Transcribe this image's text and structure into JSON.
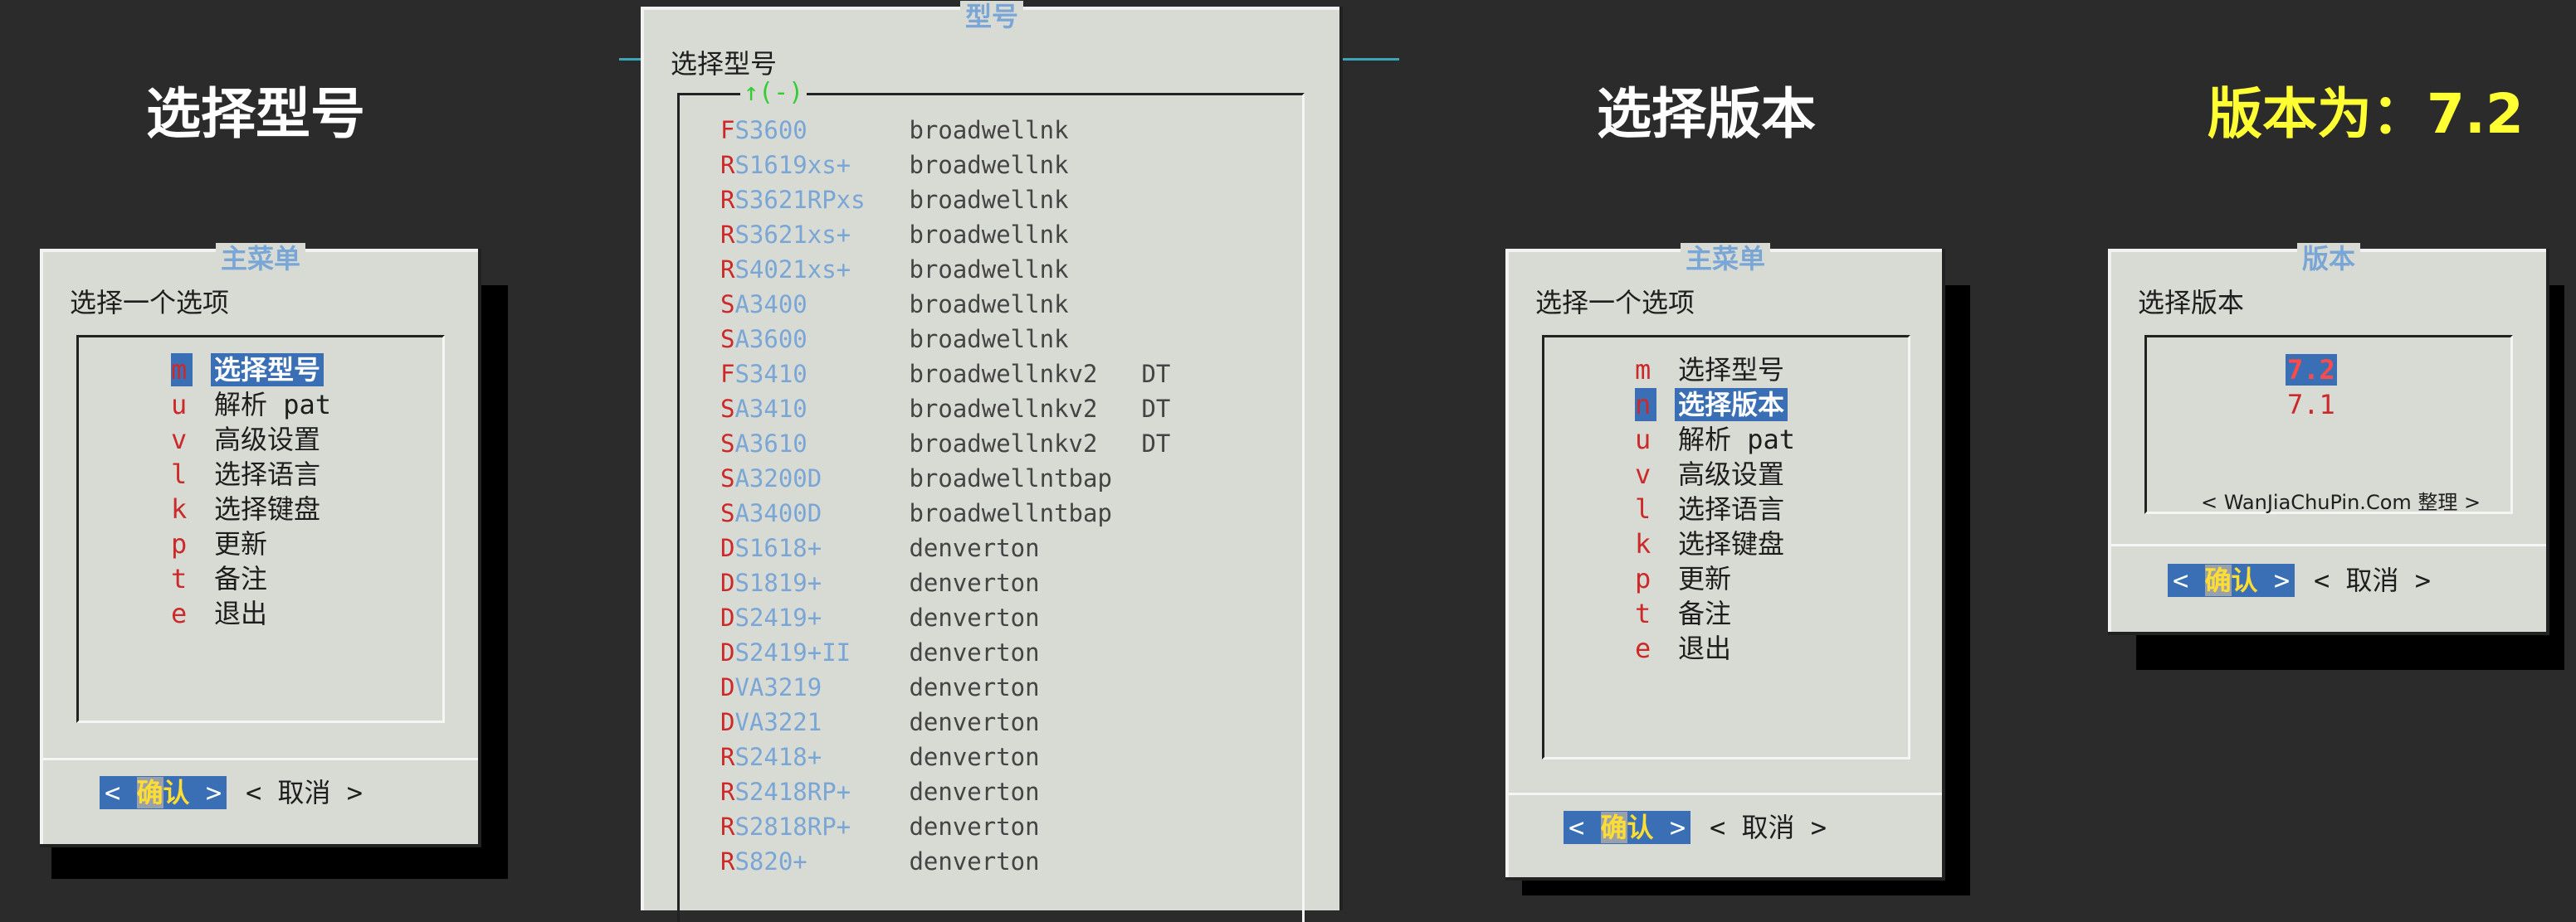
{
  "headings": {
    "select_model": "选择型号",
    "select_version": "选择版本",
    "version_result": "版本为：7.2"
  },
  "menu1": {
    "title": "主菜单",
    "prompt": "选择一个选项",
    "items": [
      {
        "key": "m",
        "label": "选择型号"
      },
      {
        "key": "u",
        "label": "解析 pat"
      },
      {
        "key": "v",
        "label": "高级设置"
      },
      {
        "key": "l",
        "label": "选择语言"
      },
      {
        "key": "k",
        "label": "选择键盘"
      },
      {
        "key": "p",
        "label": "更新"
      },
      {
        "key": "t",
        "label": "备注"
      },
      {
        "key": "e",
        "label": "退出"
      }
    ],
    "ok": {
      "left": "<",
      "hot": "确",
      "rest": "认",
      "right": ">"
    },
    "cancel": "< 取消 >"
  },
  "models": {
    "title": "型号",
    "prompt": "选择型号",
    "scroll_indicator": "↑(-)",
    "items": [
      {
        "k": "F",
        "n": "S3600",
        "p": "broadwellnk",
        "t": ""
      },
      {
        "k": "R",
        "n": "S1619xs+",
        "p": "broadwellnk",
        "t": ""
      },
      {
        "k": "R",
        "n": "S3621RPxs",
        "p": "broadwellnk",
        "t": ""
      },
      {
        "k": "R",
        "n": "S3621xs+",
        "p": "broadwellnk",
        "t": ""
      },
      {
        "k": "R",
        "n": "S4021xs+",
        "p": "broadwellnk",
        "t": ""
      },
      {
        "k": "S",
        "n": "A3400",
        "p": "broadwellnk",
        "t": ""
      },
      {
        "k": "S",
        "n": "A3600",
        "p": "broadwellnk",
        "t": ""
      },
      {
        "k": "F",
        "n": "S3410",
        "p": "broadwellnkv2",
        "t": "DT"
      },
      {
        "k": "S",
        "n": "A3410",
        "p": "broadwellnkv2",
        "t": "DT"
      },
      {
        "k": "S",
        "n": "A3610",
        "p": "broadwellnkv2",
        "t": "DT"
      },
      {
        "k": "S",
        "n": "A3200D",
        "p": "broadwellntbap",
        "t": ""
      },
      {
        "k": "S",
        "n": "A3400D",
        "p": "broadwellntbap",
        "t": ""
      },
      {
        "k": "D",
        "n": "S1618+",
        "p": "denverton",
        "t": ""
      },
      {
        "k": "D",
        "n": "S1819+",
        "p": "denverton",
        "t": ""
      },
      {
        "k": "D",
        "n": "S2419+",
        "p": "denverton",
        "t": ""
      },
      {
        "k": "D",
        "n": "S2419+II",
        "p": "denverton",
        "t": ""
      },
      {
        "k": "D",
        "n": "VA3219",
        "p": "denverton",
        "t": ""
      },
      {
        "k": "D",
        "n": "VA3221",
        "p": "denverton",
        "t": ""
      },
      {
        "k": "R",
        "n": "S2418+",
        "p": "denverton",
        "t": ""
      },
      {
        "k": "R",
        "n": "S2418RP+",
        "p": "denverton",
        "t": ""
      },
      {
        "k": "R",
        "n": "S2818RP+",
        "p": "denverton",
        "t": ""
      },
      {
        "k": "R",
        "n": "S820+",
        "p": "denverton",
        "t": ""
      }
    ]
  },
  "menu2": {
    "title": "主菜单",
    "prompt": "选择一个选项",
    "items": [
      {
        "key": "m",
        "label": "选择型号"
      },
      {
        "key": "n",
        "label": "选择版本"
      },
      {
        "key": "u",
        "label": "解析 pat"
      },
      {
        "key": "v",
        "label": "高级设置"
      },
      {
        "key": "l",
        "label": "选择语言"
      },
      {
        "key": "k",
        "label": "选择键盘"
      },
      {
        "key": "p",
        "label": "更新"
      },
      {
        "key": "t",
        "label": "备注"
      },
      {
        "key": "e",
        "label": "退出"
      }
    ],
    "ok": {
      "left": "<",
      "hot": "确",
      "rest": "认",
      "right": ">"
    },
    "cancel": "< 取消 >"
  },
  "versions": {
    "title": "版本",
    "prompt": "选择版本",
    "items": [
      "7.2",
      "7.1"
    ],
    "credit": "< WanJiaChuPin.Com 整理 >",
    "ok": {
      "left": "<",
      "hot": "确",
      "rest": "认",
      "right": ">"
    },
    "cancel": "< 取消 >"
  }
}
